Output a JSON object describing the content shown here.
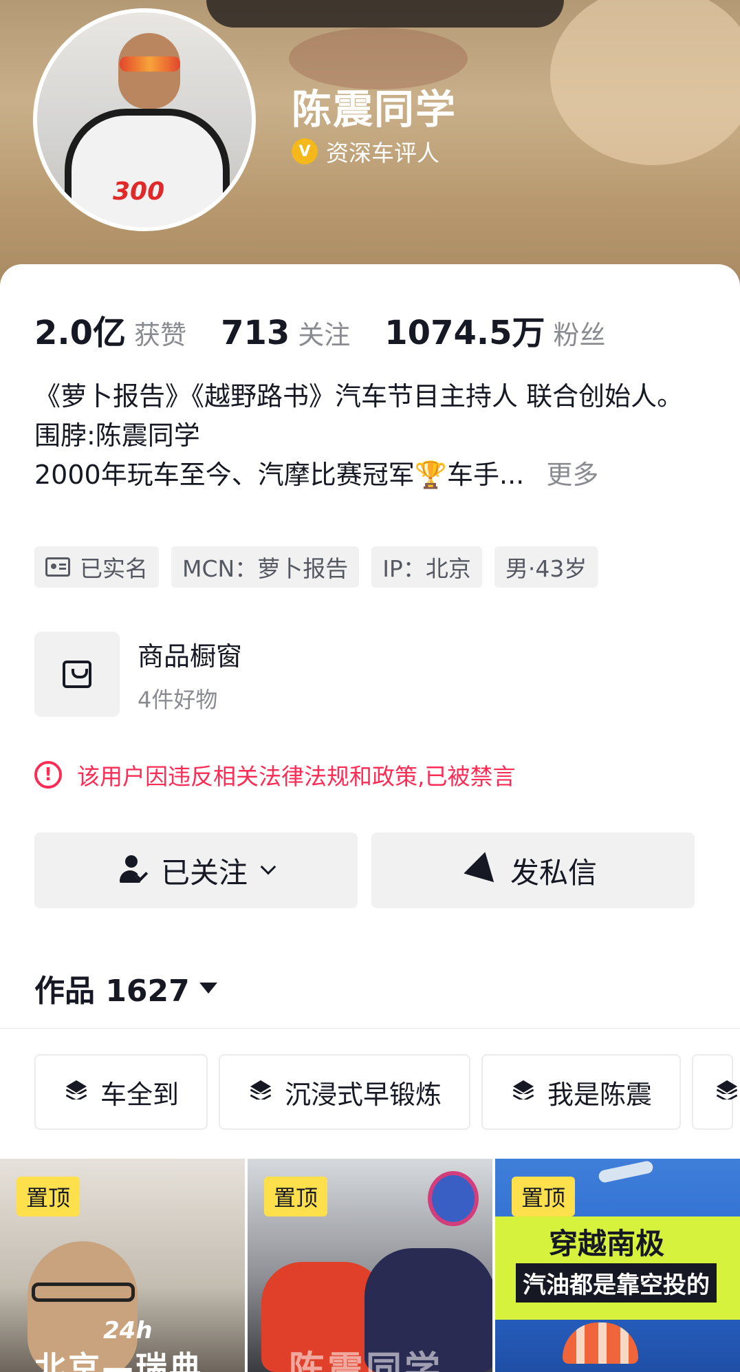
{
  "profile": {
    "name": "陈震同学",
    "verify_label": "资深车评人",
    "verify_icon": "v-badge-icon"
  },
  "stats": [
    {
      "value": "2.0亿",
      "label": "获赞"
    },
    {
      "value": "713",
      "label": "关注"
    },
    {
      "value": "1074.5万",
      "label": "粉丝"
    }
  ],
  "bio": {
    "line1": "《萝卜报告》《越野路书》汽车节目主持人 联合创始人。",
    "line2": "围脖:陈震同学",
    "line3": "2000年玩车至今、汽摩比赛冠军🏆车手...",
    "more": "更多"
  },
  "tags": [
    "已实名",
    "MCN：萝卜报告",
    "IP：北京",
    "男·43岁"
  ],
  "shop": {
    "title": "商品橱窗",
    "subtitle": "4件好物"
  },
  "ban_notice": "该用户因违反相关法律法规和政策,已被禁言",
  "actions": {
    "follow_label": "已关注",
    "message_label": "发私信"
  },
  "works": {
    "label": "作品 1627"
  },
  "collections": [
    "车全到",
    "沉浸式早锻炼",
    "我是陈震"
  ],
  "videos": [
    {
      "pin": "置顶",
      "overlay_sub": "24h",
      "overlay_title": "北京—瑞典"
    },
    {
      "pin": "置顶",
      "overlay_title": "陈震同学"
    },
    {
      "pin": "置顶",
      "overlay_title": "穿越南极",
      "overlay_sub": "汽油都是靠空投的"
    }
  ],
  "colors": {
    "accent_red": "#fe2c55",
    "pin_yellow": "#fde04b",
    "verify_gold": "#f4b81b"
  }
}
